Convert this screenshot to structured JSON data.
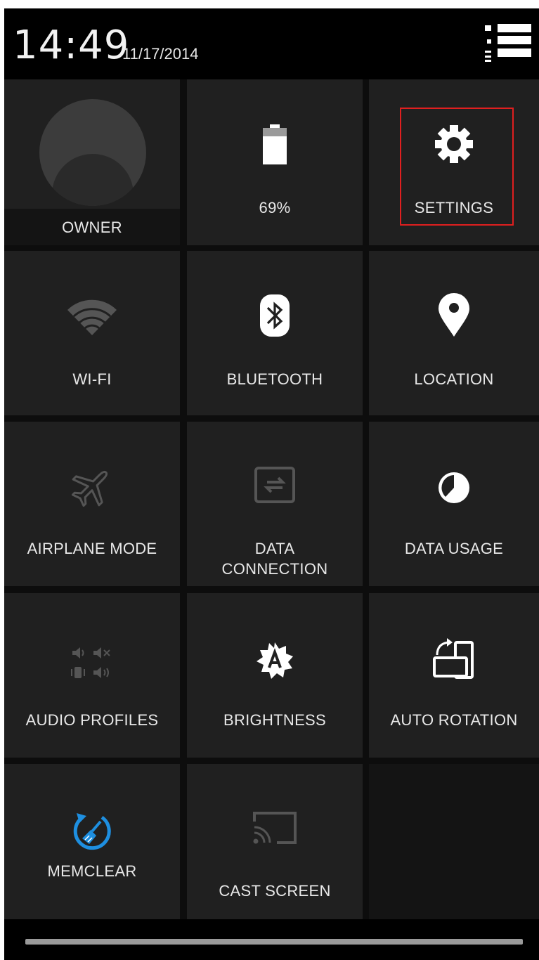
{
  "status_bar": {
    "time": "14:49",
    "date": "11/17/2014",
    "menu_icon": "list-settings-icon"
  },
  "colors": {
    "tile_background": "#202020",
    "highlight": "#e01f1f",
    "memclear_accent": "#1e8fe0",
    "disabled_icon": "#555555"
  },
  "tiles": [
    {
      "label": "OWNER",
      "icon": "user-avatar-icon",
      "state": "enabled"
    },
    {
      "label": "69%",
      "icon": "battery-icon",
      "state": "enabled",
      "battery_level": 0.69
    },
    {
      "label": "SETTINGS",
      "icon": "gear-icon",
      "state": "enabled",
      "highlighted": true
    },
    {
      "label": "WI-FI",
      "icon": "wifi-icon",
      "state": "disabled"
    },
    {
      "label": "BLUETOOTH",
      "icon": "bluetooth-icon",
      "state": "enabled"
    },
    {
      "label": "LOCATION",
      "icon": "location-pin-icon",
      "state": "enabled"
    },
    {
      "label": "AIRPLANE MODE",
      "icon": "airplane-icon",
      "state": "disabled"
    },
    {
      "label": "DATA CONNECTION",
      "label_line1": "DATA",
      "label_line2": "CONNECTION",
      "icon": "data-connection-icon",
      "state": "disabled"
    },
    {
      "label": "DATA USAGE",
      "icon": "data-usage-icon",
      "state": "enabled"
    },
    {
      "label": "AUDIO PROFILES",
      "icon": "audio-profiles-icon",
      "state": "disabled"
    },
    {
      "label": "BRIGHTNESS",
      "icon": "auto-brightness-icon",
      "state": "enabled"
    },
    {
      "label": "AUTO ROTATION",
      "icon": "auto-rotation-icon",
      "state": "enabled"
    },
    {
      "label": "MEMCLEAR",
      "icon": "memclear-broom-icon",
      "state": "enabled"
    },
    {
      "label": "CAST SCREEN",
      "icon": "cast-screen-icon",
      "state": "disabled"
    }
  ]
}
